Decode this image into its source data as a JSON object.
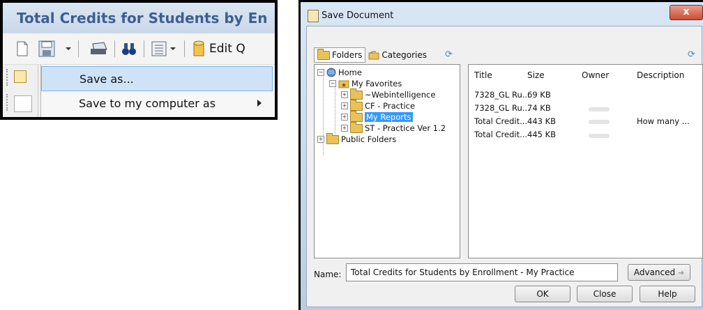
{
  "toolbar_snippet": {
    "title": "Total Credits for Students by En",
    "edit_query_label": "Edit Q",
    "menu": {
      "save_as": "Save as...",
      "save_to_computer": "Save to my computer as"
    }
  },
  "dialog": {
    "title": "Save Document",
    "close_label": "x",
    "tabs": [
      "Folders",
      "Categories"
    ],
    "tree": {
      "home": "Home",
      "my_favorites": "My Favorites",
      "webintelligence": "~Webintelligence",
      "cf_practice": "CF - Practice",
      "my_reports": "My Reports",
      "st_practice": "ST - Practice Ver 1.2",
      "public_folders": "Public Folders"
    },
    "columns": [
      "Title",
      "Size",
      "Owner",
      "Description"
    ],
    "rows": [
      {
        "title": "7328_GL Ru...",
        "size": "69 KB",
        "owner": "",
        "description": ""
      },
      {
        "title": "7328_GL Ru...",
        "size": "74 KB",
        "owner": "",
        "description": ""
      },
      {
        "title": "Total Credit...",
        "size": "443 KB",
        "owner": "",
        "description": "How many ..."
      },
      {
        "title": "Total Credit...",
        "size": "445 KB",
        "owner": "",
        "description": ""
      }
    ],
    "name_label": "Name:",
    "name_value": "Total Credits for Students by Enrollment - My  Practice",
    "advanced_label": "Advanced",
    "ok_label": "OK",
    "close_button_label": "Close",
    "help_label": "Help"
  }
}
